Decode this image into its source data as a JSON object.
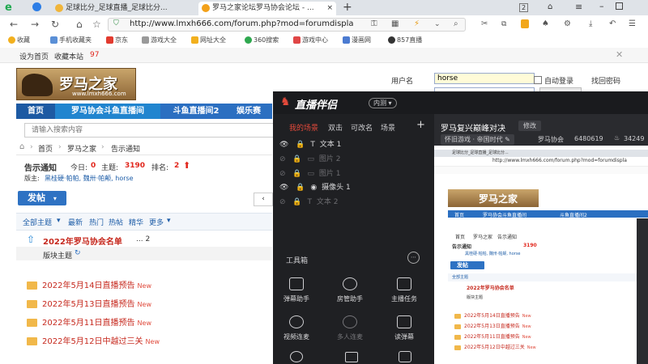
{
  "tabs": [
    {
      "label": "足球比分_足球直播_足球比分..."
    },
    {
      "label": "罗马之家论坛罗马协会论坛 - ..."
    }
  ],
  "tab_counter": "2",
  "url": "http://www.lmxh666.com/forum.php?mod=forumdispla",
  "bookmarks": [
    "收藏",
    "手机收藏夹",
    "京东",
    "游戏大全",
    "网址大全",
    "360搜索",
    "游戏中心",
    "漫画网",
    "857直播"
  ],
  "forum": {
    "top_left": "设为首页",
    "bookmark_site": "收藏本站",
    "bookmark_count": "97",
    "logo_title": "罗马之家",
    "logo_url": "www.lmxh666.com",
    "username_label": "用户名",
    "username_value": "horse",
    "auto_login": "自动登录",
    "retrieve_password": "找回密码",
    "nav": [
      "首页",
      "罗马协会斗鱼直播间",
      "斗鱼直播间2",
      "娱乐赛"
    ],
    "search_placeholder": "请输入搜索内容",
    "breadcrumb": [
      "首页",
      "罗马之家",
      "告示通知"
    ],
    "board_title": "告示通知",
    "today_label": "今日:",
    "today_value": "0",
    "topics_label": "主题:",
    "topics_value": "3190",
    "rank_label": "排名:",
    "rank_value": "2",
    "moderators_label": "版主:",
    "moderators": "黑桂硬·帕帕, 魏卅·帕颠, horse",
    "post_button": "发帖",
    "filters": [
      "全部主题",
      "最新",
      "热门",
      "热帖",
      "精华",
      "更多"
    ],
    "pinned_title": "2022年罗马协会名单",
    "pinned_pages": "... 2",
    "section_label": "版块主题",
    "threads": [
      {
        "title": "2022年5月14日直播预告",
        "tag": "New"
      },
      {
        "title": "2022年5月13日直播预告",
        "tag": "New"
      },
      {
        "title": "2022年5月11日直播预告",
        "tag": "New"
      },
      {
        "title": "2022年5月12日中越过三关",
        "tag": "New"
      }
    ]
  },
  "overlay": {
    "app_name": "直播伴侣",
    "badge": "内测",
    "tabs": [
      "我的场景",
      "双击",
      "可改名",
      "场景"
    ],
    "scenes": [
      "文本 1",
      "图片 2",
      "图片 1",
      "摄像头 1",
      "文本 2"
    ],
    "toolbox": "工具箱",
    "tools": [
      "弹幕助手",
      "房管助手",
      "主播任务",
      "视频连麦",
      "多人连麦",
      "读弹幕"
    ],
    "stream_title": "罗马复兴巅峰对决",
    "edit": "修改",
    "category": "怀旧游戏 · 帝国时代",
    "room": "罗马协会",
    "room_id": "6480619",
    "heat": "34249"
  },
  "colors": {
    "accent": "#2b6fc1",
    "red": "#e1261c",
    "overlay_bg": "#1f2023",
    "overlay_accent": "#e54a3b"
  }
}
